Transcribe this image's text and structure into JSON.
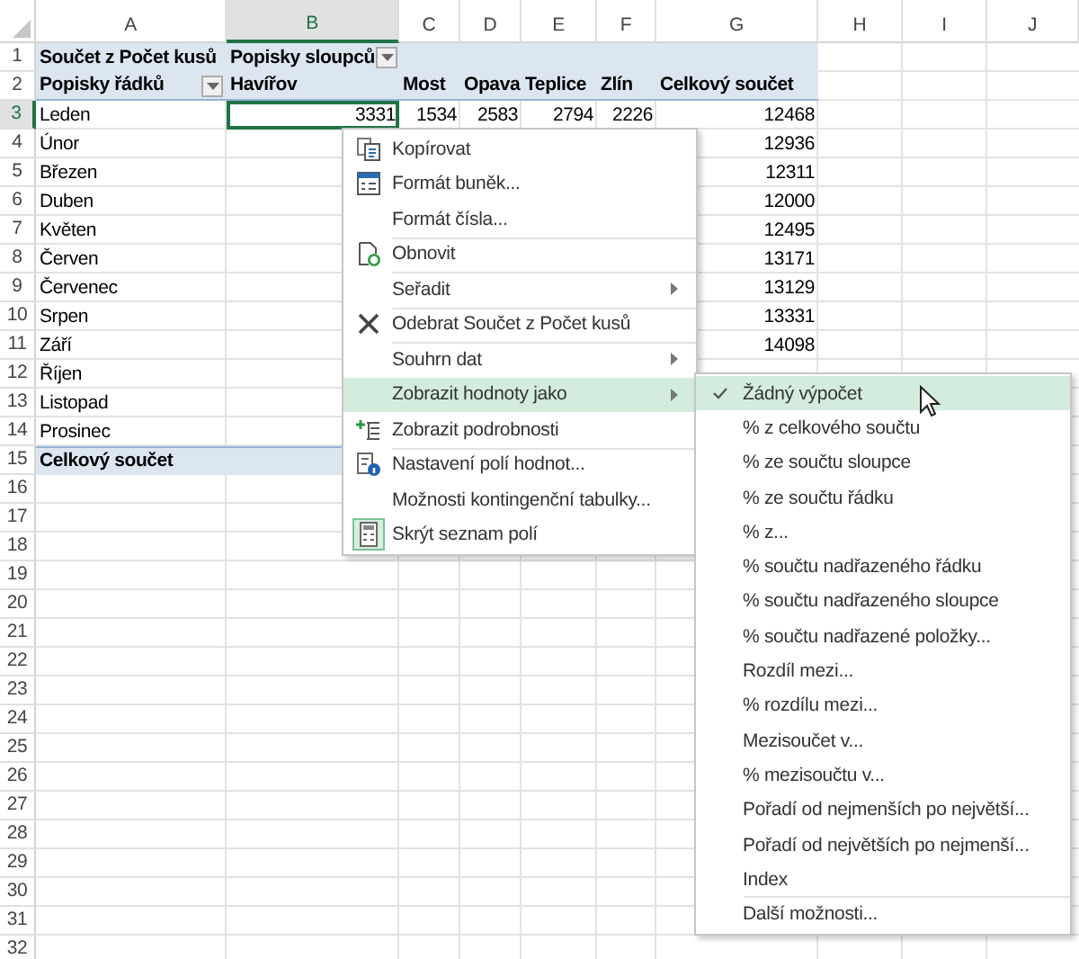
{
  "sheet": {
    "columns": [
      {
        "label": "A",
        "selected": false
      },
      {
        "label": "B",
        "selected": true
      },
      {
        "label": "C",
        "selected": false
      },
      {
        "label": "D",
        "selected": false
      },
      {
        "label": "E",
        "selected": false
      },
      {
        "label": "F",
        "selected": false
      },
      {
        "label": "G",
        "selected": false
      },
      {
        "label": "H",
        "selected": false
      },
      {
        "label": "I",
        "selected": false
      },
      {
        "label": "J",
        "selected": false
      }
    ],
    "rows": [
      {
        "number": "1",
        "selected": false,
        "kind": "title",
        "label": "Součet z Počet kusů",
        "field": "Popisky sloupců"
      },
      {
        "number": "2",
        "selected": false,
        "kind": "headings",
        "label": "Popisky řádků",
        "headings": [
          "Havířov",
          "Most",
          "Opava",
          "Teplice",
          "Zlín"
        ],
        "total": "Celkový součet"
      },
      {
        "number": "3",
        "selected": true,
        "kind": "data",
        "label": "Leden",
        "values": [
          "3331",
          "1534",
          "2583",
          "2794",
          "2226"
        ],
        "total": "12468"
      },
      {
        "number": "4",
        "selected": false,
        "kind": "data",
        "label": "Únor",
        "total": "12936"
      },
      {
        "number": "5",
        "selected": false,
        "kind": "data",
        "label": "Březen",
        "total": "12311"
      },
      {
        "number": "6",
        "selected": false,
        "kind": "data",
        "label": "Duben",
        "total": "12000"
      },
      {
        "number": "7",
        "selected": false,
        "kind": "data",
        "label": "Květen",
        "total": "12495"
      },
      {
        "number": "8",
        "selected": false,
        "kind": "data",
        "label": "Červen",
        "total": "13171"
      },
      {
        "number": "9",
        "selected": false,
        "kind": "data",
        "label": "Červenec",
        "total": "13129"
      },
      {
        "number": "10",
        "selected": false,
        "kind": "data",
        "label": "Srpen",
        "total": "13331"
      },
      {
        "number": "11",
        "selected": false,
        "kind": "data",
        "label": "Září",
        "total": "14098"
      },
      {
        "number": "12",
        "selected": false,
        "kind": "data",
        "label": "Říjen"
      },
      {
        "number": "13",
        "selected": false,
        "kind": "data",
        "label": "Listopad"
      },
      {
        "number": "14",
        "selected": false,
        "kind": "data",
        "label": "Prosinec"
      },
      {
        "number": "15",
        "selected": false,
        "kind": "total",
        "label": "Celkový součet"
      },
      {
        "number": "16",
        "selected": false,
        "kind": "empty"
      },
      {
        "number": "17",
        "selected": false,
        "kind": "empty"
      },
      {
        "number": "18",
        "selected": false,
        "kind": "empty"
      },
      {
        "number": "19",
        "selected": false,
        "kind": "empty"
      },
      {
        "number": "20",
        "selected": false,
        "kind": "empty"
      },
      {
        "number": "21",
        "selected": false,
        "kind": "empty"
      },
      {
        "number": "22",
        "selected": false,
        "kind": "empty"
      },
      {
        "number": "23",
        "selected": false,
        "kind": "empty"
      },
      {
        "number": "24",
        "selected": false,
        "kind": "empty"
      },
      {
        "number": "25",
        "selected": false,
        "kind": "empty"
      },
      {
        "number": "26",
        "selected": false,
        "kind": "empty"
      },
      {
        "number": "27",
        "selected": false,
        "kind": "empty"
      },
      {
        "number": "28",
        "selected": false,
        "kind": "empty"
      },
      {
        "number": "29",
        "selected": false,
        "kind": "empty"
      },
      {
        "number": "30",
        "selected": false,
        "kind": "empty"
      },
      {
        "number": "31",
        "selected": false,
        "kind": "empty"
      },
      {
        "number": "32",
        "selected": false,
        "kind": "empty"
      }
    ]
  },
  "context_menu": {
    "items": [
      {
        "label": "Kopírovat",
        "divider_above": false,
        "submenu": false,
        "selected": false
      },
      {
        "label": "Formát buněk...",
        "divider_above": false,
        "submenu": false,
        "selected": false
      },
      {
        "label": "Formát čísla...",
        "divider_above": false,
        "submenu": false,
        "selected": false
      },
      {
        "label": "Obnovit",
        "divider_above": true,
        "submenu": false,
        "selected": false
      },
      {
        "label": "Seřadit",
        "divider_above": true,
        "submenu": true,
        "selected": false
      },
      {
        "label": "Odebrat Součet z Počet kusů",
        "divider_above": true,
        "submenu": false,
        "selected": false
      },
      {
        "label": "Souhrn dat",
        "divider_above": true,
        "submenu": true,
        "selected": false
      },
      {
        "label": "Zobrazit hodnoty jako",
        "divider_above": false,
        "submenu": true,
        "selected": true
      },
      {
        "label": "Zobrazit podrobnosti",
        "divider_above": false,
        "submenu": false,
        "selected": false
      },
      {
        "label": "Nastavení polí hodnot...",
        "divider_above": true,
        "submenu": false,
        "selected": false
      },
      {
        "label": "Možnosti kontingenční tabulky...",
        "divider_above": false,
        "submenu": false,
        "selected": false
      },
      {
        "label": "Skrýt seznam polí",
        "divider_above": false,
        "submenu": false,
        "selected": false
      }
    ]
  },
  "submenu": {
    "items": [
      {
        "label": "Žádný výpočet",
        "checked": true,
        "selected": true,
        "divider_above": false
      },
      {
        "label": "% z celkového součtu",
        "checked": false,
        "selected": false,
        "divider_above": false
      },
      {
        "label": "% ze součtu sloupce",
        "checked": false,
        "selected": false,
        "divider_above": false
      },
      {
        "label": "% ze součtu řádku",
        "checked": false,
        "selected": false,
        "divider_above": false
      },
      {
        "label": "% z...",
        "checked": false,
        "selected": false,
        "divider_above": false
      },
      {
        "label": "% součtu nadřazeného řádku",
        "checked": false,
        "selected": false,
        "divider_above": false
      },
      {
        "label": "% součtu nadřazeného sloupce",
        "checked": false,
        "selected": false,
        "divider_above": false
      },
      {
        "label": "% součtu nadřazené položky...",
        "checked": false,
        "selected": false,
        "divider_above": false
      },
      {
        "label": "Rozdíl mezi...",
        "checked": false,
        "selected": false,
        "divider_above": false
      },
      {
        "label": "% rozdílu mezi...",
        "checked": false,
        "selected": false,
        "divider_above": false
      },
      {
        "label": "Mezisoučet v...",
        "checked": false,
        "selected": false,
        "divider_above": false
      },
      {
        "label": "% mezisoučtu v...",
        "checked": false,
        "selected": false,
        "divider_above": false
      },
      {
        "label": "Pořadí od nejmenších po největší...",
        "checked": false,
        "selected": false,
        "divider_above": false
      },
      {
        "label": "Pořadí od největších po nejmenší...",
        "checked": false,
        "selected": false,
        "divider_above": false
      },
      {
        "label": "Index",
        "checked": false,
        "selected": false,
        "divider_above": false
      },
      {
        "label": "Další možnosti...",
        "checked": false,
        "selected": false,
        "divider_above": true
      }
    ]
  }
}
